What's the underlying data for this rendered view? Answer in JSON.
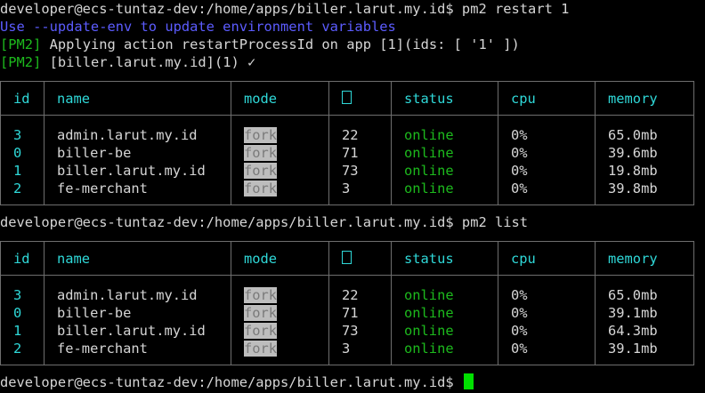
{
  "prompt": "developer@ecs-tuntaz-dev:/home/apps/biller.larut.my.id$",
  "commands": {
    "restart": "pm2 restart 1",
    "list": "pm2 list"
  },
  "output": {
    "update_env_hint": "Use --update-env to update environment variables",
    "pm2_tag": "[PM2]",
    "applying": "Applying action restartProcessId on app [1](ids: [ '1' ])",
    "restarted": "[biller.larut.my.id](1) ✓"
  },
  "columns": {
    "id": "id",
    "name": "name",
    "mode": "mode",
    "pid_glyph": "box-glyph-icon",
    "status": "status",
    "cpu": "cpu",
    "memory": "memory"
  },
  "table_restart": [
    {
      "id": "3",
      "name": "admin.larut.my.id",
      "mode": "fork",
      "pid": "22",
      "status": "online",
      "cpu": "0%",
      "memory": "65.0mb"
    },
    {
      "id": "0",
      "name": "biller-be",
      "mode": "fork",
      "pid": "71",
      "status": "online",
      "cpu": "0%",
      "memory": "39.6mb"
    },
    {
      "id": "1",
      "name": "biller.larut.my.id",
      "mode": "fork",
      "pid": "73",
      "status": "online",
      "cpu": "0%",
      "memory": "19.8mb"
    },
    {
      "id": "2",
      "name": "fe-merchant",
      "mode": "fork",
      "pid": "3",
      "status": "online",
      "cpu": "0%",
      "memory": "39.8mb"
    }
  ],
  "table_list": [
    {
      "id": "3",
      "name": "admin.larut.my.id",
      "mode": "fork",
      "pid": "22",
      "status": "online",
      "cpu": "0%",
      "memory": "65.0mb"
    },
    {
      "id": "0",
      "name": "biller-be",
      "mode": "fork",
      "pid": "71",
      "status": "online",
      "cpu": "0%",
      "memory": "39.1mb"
    },
    {
      "id": "1",
      "name": "biller.larut.my.id",
      "mode": "fork",
      "pid": "73",
      "status": "online",
      "cpu": "0%",
      "memory": "64.3mb"
    },
    {
      "id": "2",
      "name": "fe-merchant",
      "mode": "fork",
      "pid": "3",
      "status": "online",
      "cpu": "0%",
      "memory": "39.1mb"
    }
  ],
  "colors": {
    "background": "#000000",
    "text": "#d6d6d6",
    "hint": "#5c5cff",
    "pm2_tag": "#1dba1d",
    "status_online": "#1dba1d",
    "header": "#2fd8d8",
    "cursor": "#00e000"
  }
}
